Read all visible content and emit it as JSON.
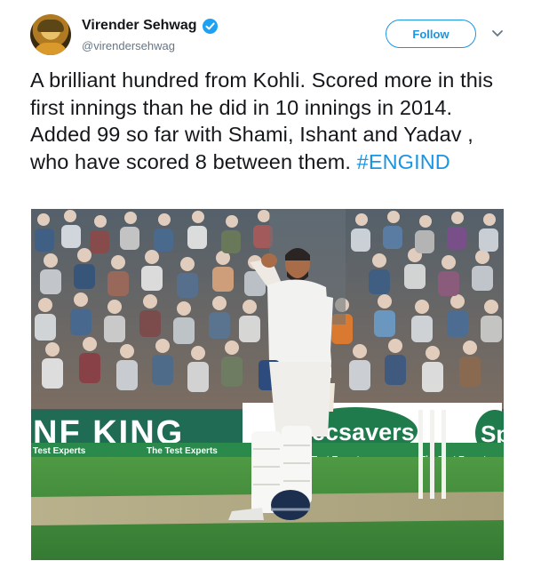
{
  "author": {
    "display_name": "Virender Sehwag",
    "handle": "@virendersehwag",
    "verified": true
  },
  "follow_button": {
    "label": "Follow"
  },
  "tweet": {
    "text": "A brilliant hundred from Kohli. Scored more in this first innings than he did in 10 innings in 2014. Added  99 so far with Shami, Ishant and Yadav , who have scored 8 between them. ",
    "hashtag": "#ENGIND"
  },
  "photo": {
    "boards": {
      "left": "NF KING",
      "mid": "ecsavers",
      "right": "Sp",
      "ribbon_1": "Test Experts",
      "ribbon_2": "The Test Experts",
      "ribbon_3": "Test Experts",
      "ribbon_4": "The Test Experts"
    }
  },
  "colors": {
    "link": "#1b95e0",
    "verified": "#1da1f2",
    "sponsor_green": "#1f7a4c",
    "field_green": "#3f8a3b",
    "jersey": "#f2f2f0"
  },
  "icons": {
    "verified": "verified-badge-icon",
    "menu": "chevron-down-icon"
  }
}
